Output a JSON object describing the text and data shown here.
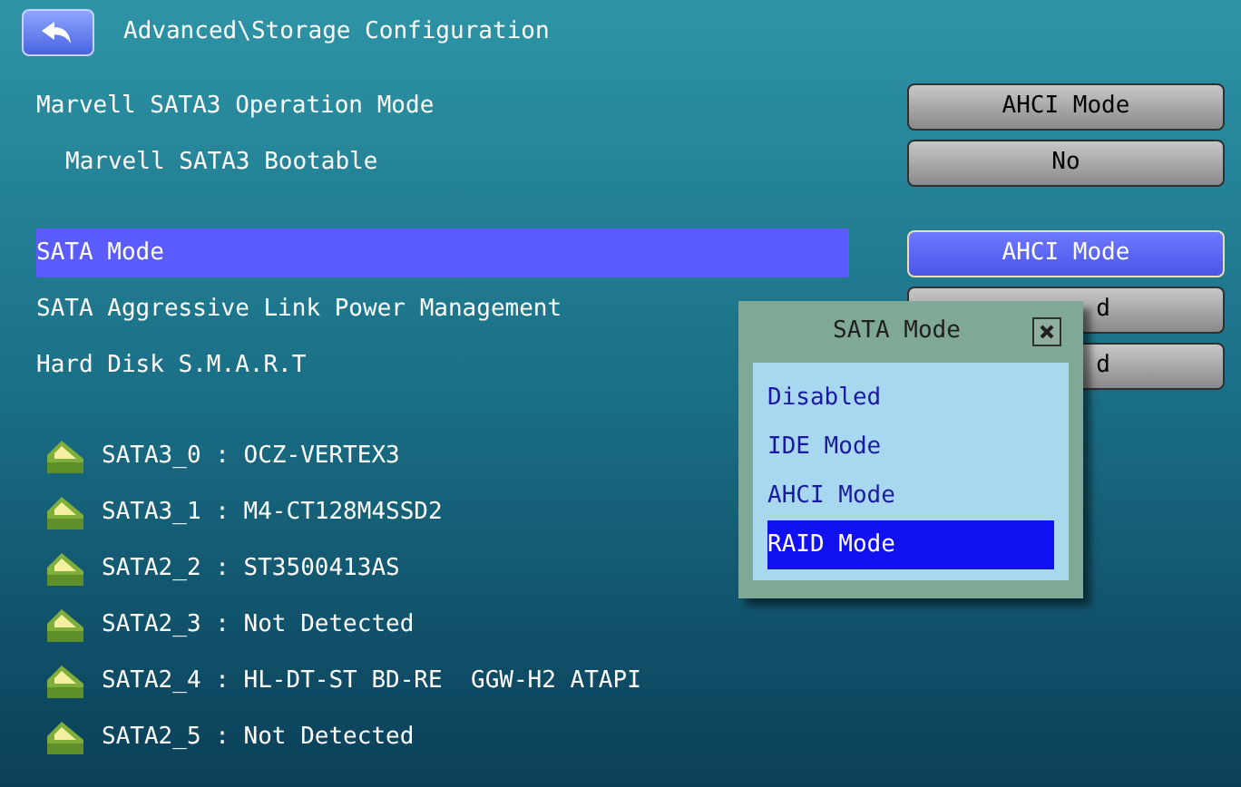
{
  "header": {
    "title": "Advanced\\Storage Configuration"
  },
  "settings": [
    {
      "label": "Marvell SATA3 Operation Mode",
      "value": "AHCI Mode",
      "indented": false,
      "selected": false
    },
    {
      "label": "Marvell SATA3 Bootable",
      "value": "No",
      "indented": true,
      "selected": false
    },
    {
      "label": "SATA Mode",
      "value": "AHCI Mode",
      "indented": false,
      "selected": true
    },
    {
      "label": "SATA Aggressive Link Power Management",
      "value": "d",
      "covered": true,
      "indented": false,
      "selected": false
    },
    {
      "label": "Hard Disk S.M.A.R.T",
      "value": "d",
      "covered": true,
      "indented": false,
      "selected": false
    }
  ],
  "devices": [
    "SATA3_0 : OCZ-VERTEX3",
    "SATA3_1 : M4-CT128M4SSD2",
    "SATA2_2 : ST3500413AS",
    "SATA2_3 : Not Detected",
    "SATA2_4 : HL-DT-ST BD-RE  GGW-H2 ATAPI",
    "SATA2_5 : Not Detected"
  ],
  "popup": {
    "title": "SATA Mode",
    "options": [
      {
        "label": "Disabled",
        "selected": false
      },
      {
        "label": "IDE Mode",
        "selected": false
      },
      {
        "label": "AHCI Mode",
        "selected": false
      },
      {
        "label": "RAID Mode",
        "selected": true
      }
    ]
  }
}
